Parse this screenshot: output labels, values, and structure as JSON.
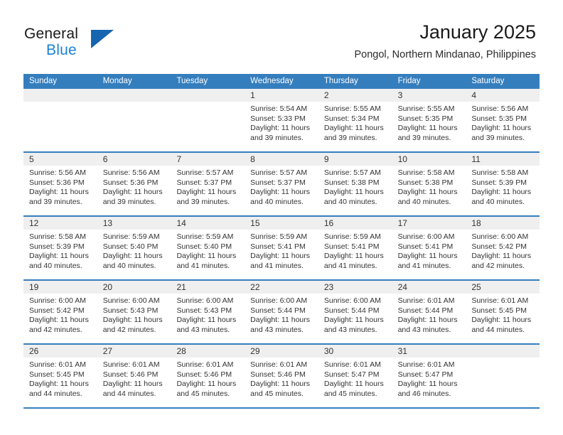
{
  "brand": {
    "name_top": "General",
    "name_bottom": "Blue",
    "triangle_color": "#1565b0",
    "blue_color": "#1a82d8"
  },
  "header": {
    "title": "January 2025",
    "subtitle": "Pongol, Northern Mindanao, Philippines"
  },
  "theme": {
    "header_blue": "#357ebd",
    "date_band_gray": "#efefef",
    "text_color": "#333333"
  },
  "weekday_headers": [
    "Sunday",
    "Monday",
    "Tuesday",
    "Wednesday",
    "Thursday",
    "Friday",
    "Saturday"
  ],
  "labels": {
    "sunrise": "Sunrise:",
    "sunset": "Sunset:",
    "daylight": "Daylight:"
  },
  "weeks": [
    [
      {
        "empty": true
      },
      {
        "empty": true
      },
      {
        "empty": true
      },
      {
        "day": "1",
        "sunrise": "Sunrise: 5:54 AM",
        "sunset": "Sunset: 5:33 PM",
        "daylight_1": "Daylight: 11 hours",
        "daylight_2": "and 39 minutes."
      },
      {
        "day": "2",
        "sunrise": "Sunrise: 5:55 AM",
        "sunset": "Sunset: 5:34 PM",
        "daylight_1": "Daylight: 11 hours",
        "daylight_2": "and 39 minutes."
      },
      {
        "day": "3",
        "sunrise": "Sunrise: 5:55 AM",
        "sunset": "Sunset: 5:35 PM",
        "daylight_1": "Daylight: 11 hours",
        "daylight_2": "and 39 minutes."
      },
      {
        "day": "4",
        "sunrise": "Sunrise: 5:56 AM",
        "sunset": "Sunset: 5:35 PM",
        "daylight_1": "Daylight: 11 hours",
        "daylight_2": "and 39 minutes."
      }
    ],
    [
      {
        "day": "5",
        "sunrise": "Sunrise: 5:56 AM",
        "sunset": "Sunset: 5:36 PM",
        "daylight_1": "Daylight: 11 hours",
        "daylight_2": "and 39 minutes."
      },
      {
        "day": "6",
        "sunrise": "Sunrise: 5:56 AM",
        "sunset": "Sunset: 5:36 PM",
        "daylight_1": "Daylight: 11 hours",
        "daylight_2": "and 39 minutes."
      },
      {
        "day": "7",
        "sunrise": "Sunrise: 5:57 AM",
        "sunset": "Sunset: 5:37 PM",
        "daylight_1": "Daylight: 11 hours",
        "daylight_2": "and 39 minutes."
      },
      {
        "day": "8",
        "sunrise": "Sunrise: 5:57 AM",
        "sunset": "Sunset: 5:37 PM",
        "daylight_1": "Daylight: 11 hours",
        "daylight_2": "and 40 minutes."
      },
      {
        "day": "9",
        "sunrise": "Sunrise: 5:57 AM",
        "sunset": "Sunset: 5:38 PM",
        "daylight_1": "Daylight: 11 hours",
        "daylight_2": "and 40 minutes."
      },
      {
        "day": "10",
        "sunrise": "Sunrise: 5:58 AM",
        "sunset": "Sunset: 5:38 PM",
        "daylight_1": "Daylight: 11 hours",
        "daylight_2": "and 40 minutes."
      },
      {
        "day": "11",
        "sunrise": "Sunrise: 5:58 AM",
        "sunset": "Sunset: 5:39 PM",
        "daylight_1": "Daylight: 11 hours",
        "daylight_2": "and 40 minutes."
      }
    ],
    [
      {
        "day": "12",
        "sunrise": "Sunrise: 5:58 AM",
        "sunset": "Sunset: 5:39 PM",
        "daylight_1": "Daylight: 11 hours",
        "daylight_2": "and 40 minutes."
      },
      {
        "day": "13",
        "sunrise": "Sunrise: 5:59 AM",
        "sunset": "Sunset: 5:40 PM",
        "daylight_1": "Daylight: 11 hours",
        "daylight_2": "and 40 minutes."
      },
      {
        "day": "14",
        "sunrise": "Sunrise: 5:59 AM",
        "sunset": "Sunset: 5:40 PM",
        "daylight_1": "Daylight: 11 hours",
        "daylight_2": "and 41 minutes."
      },
      {
        "day": "15",
        "sunrise": "Sunrise: 5:59 AM",
        "sunset": "Sunset: 5:41 PM",
        "daylight_1": "Daylight: 11 hours",
        "daylight_2": "and 41 minutes."
      },
      {
        "day": "16",
        "sunrise": "Sunrise: 5:59 AM",
        "sunset": "Sunset: 5:41 PM",
        "daylight_1": "Daylight: 11 hours",
        "daylight_2": "and 41 minutes."
      },
      {
        "day": "17",
        "sunrise": "Sunrise: 6:00 AM",
        "sunset": "Sunset: 5:41 PM",
        "daylight_1": "Daylight: 11 hours",
        "daylight_2": "and 41 minutes."
      },
      {
        "day": "18",
        "sunrise": "Sunrise: 6:00 AM",
        "sunset": "Sunset: 5:42 PM",
        "daylight_1": "Daylight: 11 hours",
        "daylight_2": "and 42 minutes."
      }
    ],
    [
      {
        "day": "19",
        "sunrise": "Sunrise: 6:00 AM",
        "sunset": "Sunset: 5:42 PM",
        "daylight_1": "Daylight: 11 hours",
        "daylight_2": "and 42 minutes."
      },
      {
        "day": "20",
        "sunrise": "Sunrise: 6:00 AM",
        "sunset": "Sunset: 5:43 PM",
        "daylight_1": "Daylight: 11 hours",
        "daylight_2": "and 42 minutes."
      },
      {
        "day": "21",
        "sunrise": "Sunrise: 6:00 AM",
        "sunset": "Sunset: 5:43 PM",
        "daylight_1": "Daylight: 11 hours",
        "daylight_2": "and 43 minutes."
      },
      {
        "day": "22",
        "sunrise": "Sunrise: 6:00 AM",
        "sunset": "Sunset: 5:44 PM",
        "daylight_1": "Daylight: 11 hours",
        "daylight_2": "and 43 minutes."
      },
      {
        "day": "23",
        "sunrise": "Sunrise: 6:00 AM",
        "sunset": "Sunset: 5:44 PM",
        "daylight_1": "Daylight: 11 hours",
        "daylight_2": "and 43 minutes."
      },
      {
        "day": "24",
        "sunrise": "Sunrise: 6:01 AM",
        "sunset": "Sunset: 5:44 PM",
        "daylight_1": "Daylight: 11 hours",
        "daylight_2": "and 43 minutes."
      },
      {
        "day": "25",
        "sunrise": "Sunrise: 6:01 AM",
        "sunset": "Sunset: 5:45 PM",
        "daylight_1": "Daylight: 11 hours",
        "daylight_2": "and 44 minutes."
      }
    ],
    [
      {
        "day": "26",
        "sunrise": "Sunrise: 6:01 AM",
        "sunset": "Sunset: 5:45 PM",
        "daylight_1": "Daylight: 11 hours",
        "daylight_2": "and 44 minutes."
      },
      {
        "day": "27",
        "sunrise": "Sunrise: 6:01 AM",
        "sunset": "Sunset: 5:46 PM",
        "daylight_1": "Daylight: 11 hours",
        "daylight_2": "and 44 minutes."
      },
      {
        "day": "28",
        "sunrise": "Sunrise: 6:01 AM",
        "sunset": "Sunset: 5:46 PM",
        "daylight_1": "Daylight: 11 hours",
        "daylight_2": "and 45 minutes."
      },
      {
        "day": "29",
        "sunrise": "Sunrise: 6:01 AM",
        "sunset": "Sunset: 5:46 PM",
        "daylight_1": "Daylight: 11 hours",
        "daylight_2": "and 45 minutes."
      },
      {
        "day": "30",
        "sunrise": "Sunrise: 6:01 AM",
        "sunset": "Sunset: 5:47 PM",
        "daylight_1": "Daylight: 11 hours",
        "daylight_2": "and 45 minutes."
      },
      {
        "day": "31",
        "sunrise": "Sunrise: 6:01 AM",
        "sunset": "Sunset: 5:47 PM",
        "daylight_1": "Daylight: 11 hours",
        "daylight_2": "and 46 minutes."
      },
      {
        "empty": true
      }
    ]
  ]
}
